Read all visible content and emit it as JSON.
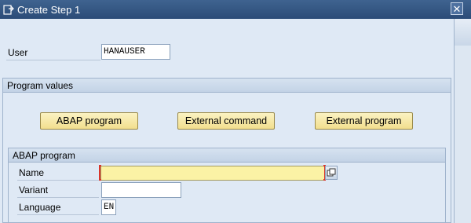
{
  "window": {
    "title": "Create Step  1",
    "close_glyph": "✕"
  },
  "user": {
    "label": "User",
    "value": "HANAUSER"
  },
  "program_values": {
    "header": "Program values",
    "buttons": [
      "ABAP program",
      "External command",
      "External program"
    ]
  },
  "abap_program": {
    "header": "ABAP program",
    "name": {
      "label": "Name",
      "value": ""
    },
    "variant": {
      "label": "Variant",
      "value": ""
    },
    "language": {
      "label": "Language",
      "value": "EN"
    }
  },
  "icons": {
    "title": "create-document-icon",
    "help": "value-help-icon"
  },
  "colors": {
    "titlebar": "#2f5282",
    "dialog_bg": "#dfe9f5",
    "button_fill": "#f4e49c",
    "required_field": "#fbf2a5",
    "required_marker": "#d9352b"
  }
}
